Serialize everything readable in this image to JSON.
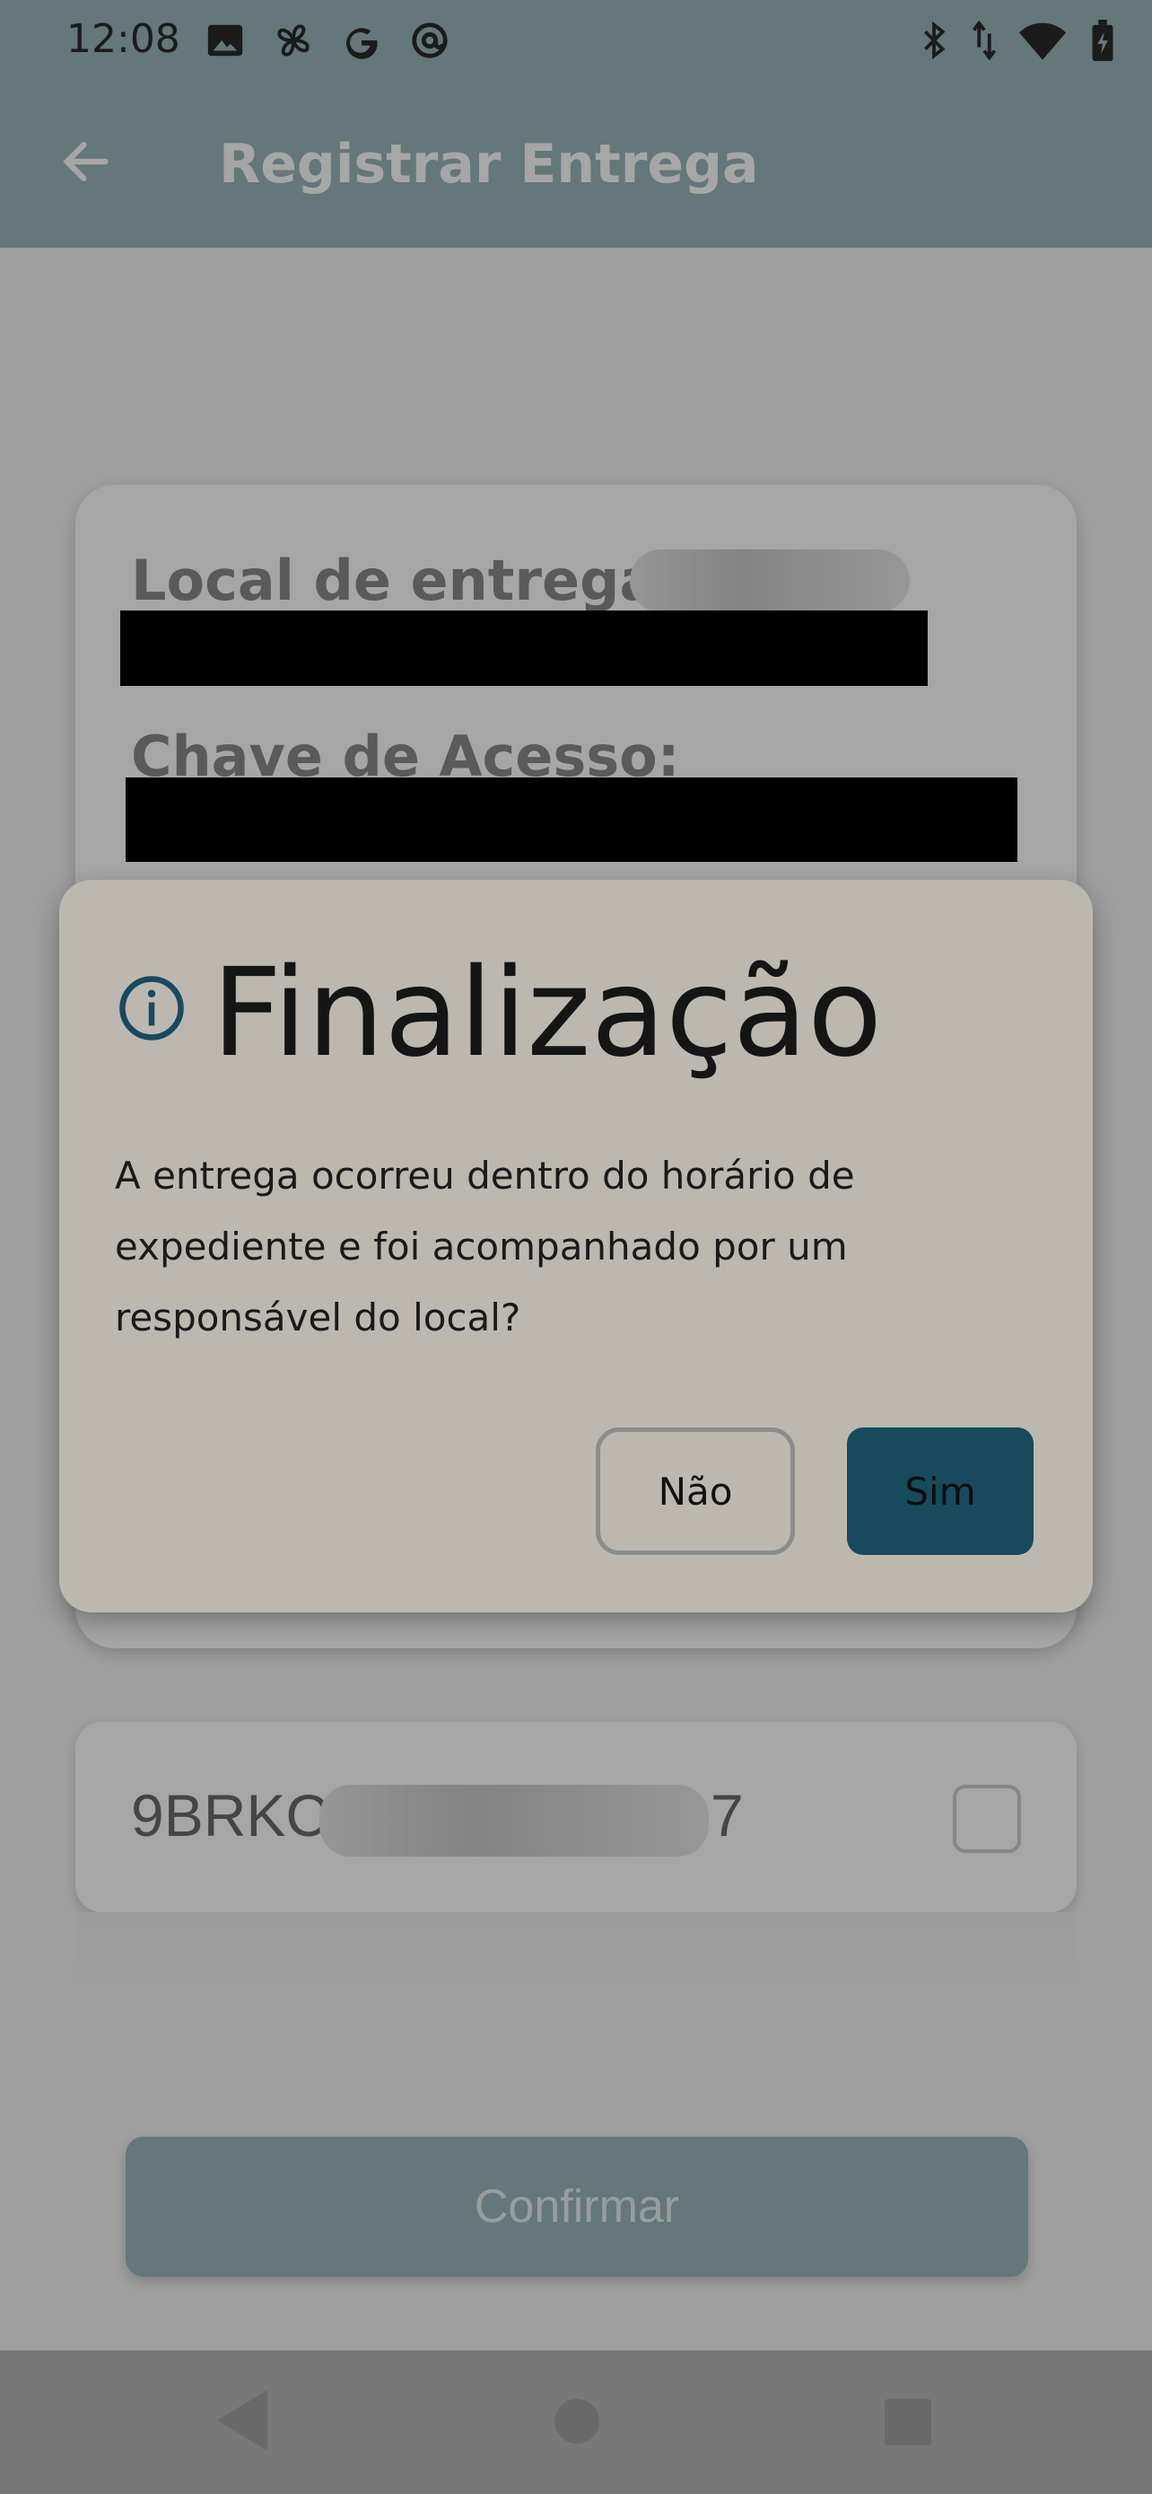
{
  "status_bar": {
    "time": "12:08",
    "left_icons": [
      "image-icon",
      "pinwheel-icon",
      "google-icon",
      "at-sign-icon"
    ],
    "right_icons": [
      "bluetooth-icon",
      "data-arrows-icon",
      "wifi-icon",
      "battery-charging-icon"
    ]
  },
  "app_bar": {
    "title": "Registrar Entrega",
    "back_icon": "arrow-left-icon"
  },
  "card": {
    "local_label": "Local de entrega:",
    "chave_label": "Chave de Acesso:"
  },
  "item": {
    "code_start": "9BRKC",
    "code_end": "7"
  },
  "confirm_label": "Confirmar",
  "dialog": {
    "icon": "info-icon",
    "title": "Finalização",
    "message": "A entrega ocorreu dentro do horário de expediente e foi acompanhado por um responsável do local?",
    "no_label": "Não",
    "yes_label": "Sim"
  },
  "colors": {
    "app_bar": "#9ab7be",
    "primary": "#184a5e",
    "dialog_bg": "#bcb8b0"
  }
}
